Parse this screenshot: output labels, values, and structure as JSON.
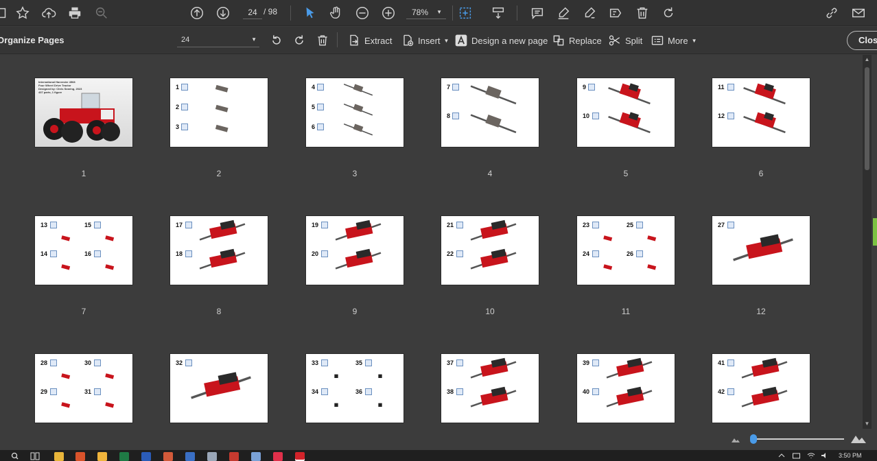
{
  "toolbar": {
    "current_page": "24",
    "total_pages": "/ 98",
    "zoom": "78%"
  },
  "organize": {
    "title": "Organize Pages",
    "page_select": "24",
    "extract": "Extract",
    "insert": "Insert",
    "design_new": "Design a new page",
    "replace": "Replace",
    "split": "Split",
    "more": "More",
    "close": "Close"
  },
  "cover": {
    "line1": "International Harvester 4568",
    "line2": "Four Wheel Drive Tractor",
    "line3": "Designed by: Chris Searing, 2023",
    "line4": "437 parts, 1 figure"
  },
  "pages": [
    {
      "label": "1",
      "steps": []
    },
    {
      "label": "2",
      "steps": [
        "1",
        "2",
        "3"
      ]
    },
    {
      "label": "3",
      "steps": [
        "4",
        "5",
        "6"
      ]
    },
    {
      "label": "4",
      "steps": [
        "7",
        "8"
      ]
    },
    {
      "label": "5",
      "steps": [
        "9",
        "10"
      ]
    },
    {
      "label": "6",
      "steps": [
        "11",
        "12"
      ]
    },
    {
      "label": "7",
      "steps": [
        "13",
        "15",
        "14",
        "16"
      ]
    },
    {
      "label": "8",
      "steps": [
        "17",
        "18"
      ]
    },
    {
      "label": "9",
      "steps": [
        "19",
        "20"
      ]
    },
    {
      "label": "10",
      "steps": [
        "21",
        "22"
      ]
    },
    {
      "label": "11",
      "steps": [
        "23",
        "25",
        "24",
        "26"
      ]
    },
    {
      "label": "12",
      "steps": [
        "27"
      ]
    },
    {
      "label": "",
      "steps": [
        "28",
        "30",
        "29",
        "31"
      ]
    },
    {
      "label": "",
      "steps": [
        "32"
      ]
    },
    {
      "label": "",
      "steps": [
        "33",
        "35",
        "34",
        "36"
      ]
    },
    {
      "label": "",
      "steps": [
        "37",
        "38"
      ]
    },
    {
      "label": "",
      "steps": [
        "39",
        "40"
      ]
    },
    {
      "label": "",
      "steps": [
        "41",
        "42"
      ]
    }
  ],
  "taskbar": {
    "clock": "3:50 PM"
  },
  "colors": {
    "accent": "#4a9be8",
    "brick_red": "#c8141c",
    "brick_dark": "#2a2a2a",
    "green_tab": "#7cc242"
  }
}
